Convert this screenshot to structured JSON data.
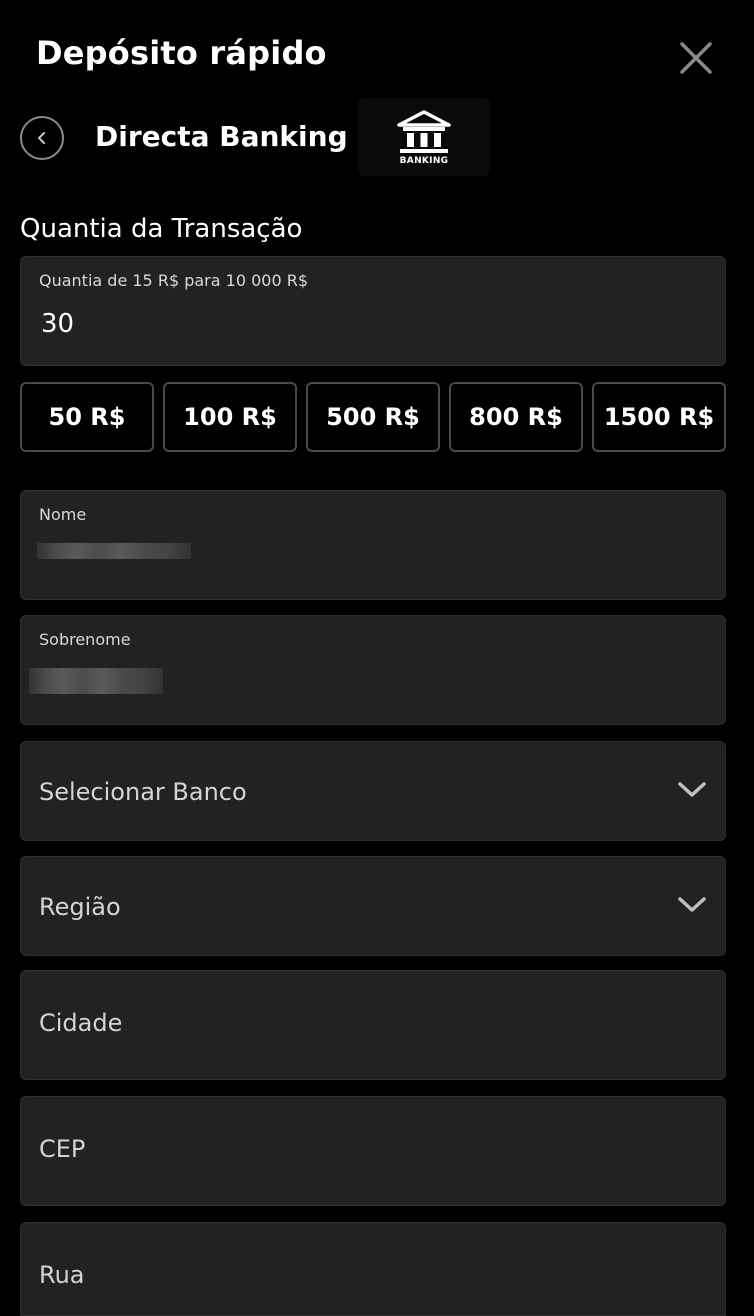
{
  "header": {
    "title": "Depósito rápido"
  },
  "method": {
    "name": "Directa Banking",
    "logo_text": "BANKING"
  },
  "amount_section": {
    "label": "Quantia da Transação",
    "field_label": "Quantia de 15 R$ para 10 000 R$",
    "value": "30"
  },
  "quick_amounts": [
    "50 R$",
    "100 R$",
    "500 R$",
    "800 R$",
    "1500 R$"
  ],
  "form": {
    "first_name_label": "Nome",
    "last_name_label": "Sobrenome",
    "bank_placeholder": "Selecionar Banco",
    "region_placeholder": "Região",
    "city_placeholder": "Cidade",
    "zip_placeholder": "CEP",
    "street_placeholder": "Rua"
  },
  "colors": {
    "background": "#000000",
    "field_background": "#222222",
    "text": "#ffffff"
  }
}
